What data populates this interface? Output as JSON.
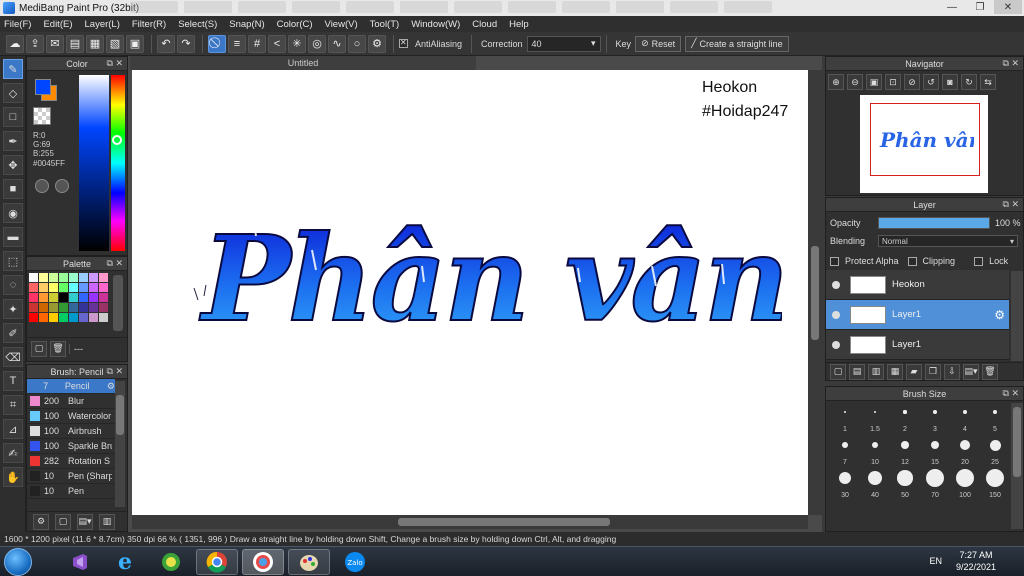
{
  "window": {
    "title": "MediBang Paint Pro (32bit)",
    "controls": [
      "—",
      "❐",
      "✕"
    ]
  },
  "menu": [
    "File(F)",
    "Edit(E)",
    "Layer(L)",
    "Filter(R)",
    "Select(S)",
    "Snap(N)",
    "Color(C)",
    "View(V)",
    "Tool(T)",
    "Window(W)",
    "Cloud",
    "Help"
  ],
  "toolbar": {
    "antialiasing_label": "AntiAliasing",
    "correction_label": "Correction",
    "correction_value": "40",
    "key_label": "Key",
    "reset_label": "Reset",
    "straight_line_label": "Create a straight line"
  },
  "color_panel": {
    "title": "Color",
    "primary": "#0045FF",
    "secondary": "#FF8A00",
    "r": "R:0",
    "g": "G:69",
    "b": "B:255",
    "hex": "#0045FF"
  },
  "palette_panel": {
    "title": "Palette",
    "footer": "---",
    "colors": [
      "#ffffff",
      "#ffff99",
      "#ccff99",
      "#99ff99",
      "#99ffcc",
      "#99ccff",
      "#cc99ff",
      "#ff99cc",
      "#ff6666",
      "#ffcc66",
      "#ffff66",
      "#66ff66",
      "#66ffff",
      "#6699ff",
      "#cc66ff",
      "#ff66cc",
      "#ff3366",
      "#ff9933",
      "#cccc33",
      "#000000",
      "#33cccc",
      "#3366ff",
      "#9933ff",
      "#cc3399",
      "#cc3333",
      "#cc6600",
      "#999933",
      "#339933",
      "#336699",
      "#333399",
      "#663399",
      "#993366",
      "#ff0000",
      "#ff6600",
      "#ffcc00",
      "#00cc66",
      "#0099cc",
      "#6666cc",
      "#cc99cc",
      "#cccccc"
    ]
  },
  "brush_panel": {
    "title": "Brush: Pencil",
    "items": [
      {
        "size": "7",
        "name": "Pencil",
        "color": "#3c78c8"
      },
      {
        "size": "200",
        "name": "Blur",
        "color": "#ee88cc"
      },
      {
        "size": "100",
        "name": "Watercolor",
        "color": "#66ccff"
      },
      {
        "size": "100",
        "name": "Airbrush",
        "color": "#dddddd"
      },
      {
        "size": "100",
        "name": "Sparkle Brush",
        "color": "#3355ee"
      },
      {
        "size": "282",
        "name": "Rotation S",
        "color": "#ee3333"
      },
      {
        "size": "10",
        "name": "Pen (Sharp)",
        "color": "#222222"
      },
      {
        "size": "10",
        "name": "Pen",
        "color": "#222222"
      }
    ]
  },
  "canvas": {
    "tab": "Untitled",
    "watermark_line1": "Heokon",
    "watermark_line2": "#Hoidap247",
    "lettering": "Phân vân"
  },
  "navigator": {
    "title": "Navigator"
  },
  "layer_panel": {
    "title": "Layer",
    "opacity_label": "Opacity",
    "opacity_value": "100 %",
    "opacity_fraction": 1.0,
    "blending_label": "Blending",
    "blending_value": "Normal",
    "protect_alpha": "Protect Alpha",
    "clipping": "Clipping",
    "lock": "Lock",
    "layers": [
      {
        "name": "Heokon",
        "selected": false
      },
      {
        "name": "Layer1",
        "selected": true
      },
      {
        "name": "Layer1",
        "selected": false
      }
    ]
  },
  "brush_size_panel": {
    "title": "Brush Size",
    "sizes": [
      "1",
      "1.5",
      "2",
      "3",
      "4",
      "5",
      "7",
      "10",
      "12",
      "15",
      "20",
      "25",
      "30",
      "40",
      "50",
      "70",
      "100",
      "150"
    ]
  },
  "status": {
    "text": "1600 * 1200 pixel   (11.6 * 8.7cm)   350 dpi   66 %   ( 1351, 996 )   Draw a straight line by holding down Shift, Change a brush size by holding down Ctrl, Alt, and dragging"
  },
  "taskbar": {
    "language": "EN",
    "time": "7:27 AM",
    "date": "9/22/2021"
  }
}
